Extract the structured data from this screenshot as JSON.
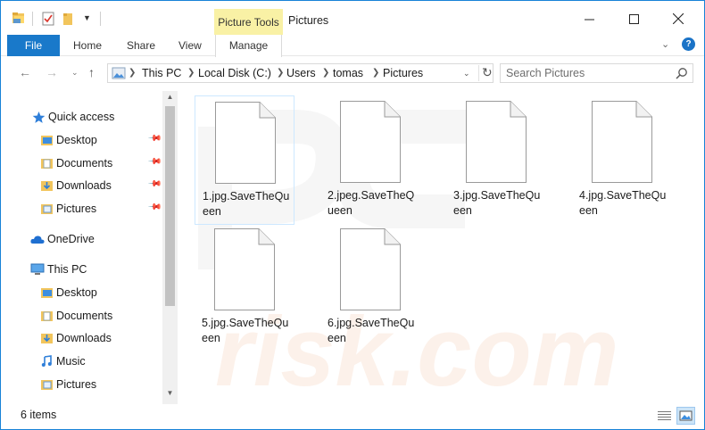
{
  "window": {
    "title": "Pictures",
    "contextual_tab_group": "Picture Tools"
  },
  "ribbon": {
    "tabs": [
      {
        "label": "File"
      },
      {
        "label": "Home"
      },
      {
        "label": "Share"
      },
      {
        "label": "View"
      },
      {
        "label": "Manage"
      }
    ],
    "accent_color": "#1979ca",
    "context_color": "#f9f1a5"
  },
  "address": {
    "crumbs": [
      "This PC",
      "Local Disk (C:)",
      "Users",
      "tomas",
      "Pictures"
    ]
  },
  "search": {
    "placeholder": "Search Pictures"
  },
  "navpane": {
    "quick_access": "Quick access",
    "quick_items": [
      {
        "label": "Desktop",
        "icon": "desktop-folder-icon"
      },
      {
        "label": "Documents",
        "icon": "documents-folder-icon"
      },
      {
        "label": "Downloads",
        "icon": "downloads-folder-icon"
      },
      {
        "label": "Pictures",
        "icon": "pictures-folder-icon"
      }
    ],
    "onedrive": "OneDrive",
    "this_pc": "This PC",
    "pc_items": [
      {
        "label": "Desktop",
        "icon": "desktop-folder-icon"
      },
      {
        "label": "Documents",
        "icon": "documents-folder-icon"
      },
      {
        "label": "Downloads",
        "icon": "downloads-folder-icon"
      },
      {
        "label": "Music",
        "icon": "music-folder-icon"
      },
      {
        "label": "Pictures",
        "icon": "pictures-folder-icon"
      }
    ]
  },
  "files": [
    {
      "name": "1.jpg.SaveTheQueen",
      "line1": "1.jpg.SaveTheQu",
      "line2": "een",
      "selected": true
    },
    {
      "name": "2.jpeg.SaveTheQueen",
      "line1": "2.jpeg.SaveTheQ",
      "line2": "ueen",
      "selected": false
    },
    {
      "name": "3.jpg.SaveTheQueen",
      "line1": "3.jpg.SaveTheQu",
      "line2": "een",
      "selected": false
    },
    {
      "name": "4.jpg.SaveTheQueen",
      "line1": "4.jpg.SaveTheQu",
      "line2": "een",
      "selected": false
    },
    {
      "name": "5.jpg.SaveTheQueen",
      "line1": "5.jpg.SaveTheQu",
      "line2": "een",
      "selected": false
    },
    {
      "name": "6.jpg.SaveTheQueen",
      "line1": "6.jpg.SaveTheQu",
      "line2": "een",
      "selected": false
    }
  ],
  "status": {
    "item_count": "6 items"
  }
}
